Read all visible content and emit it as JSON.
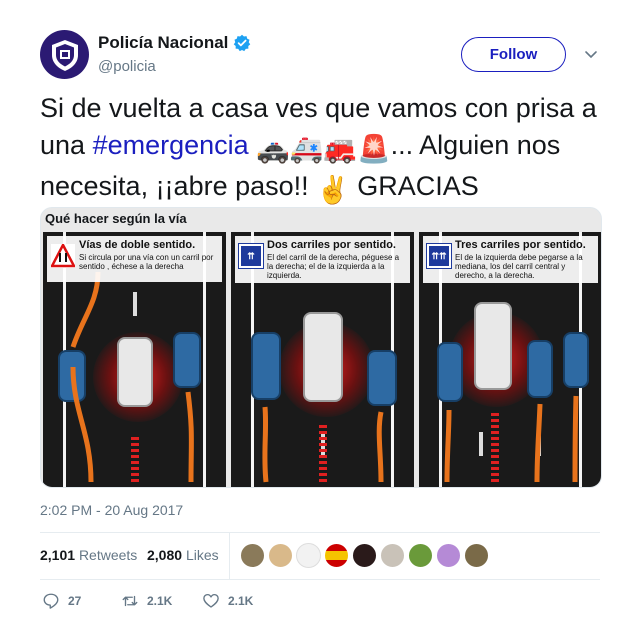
{
  "account": {
    "display_name": "Policía Nacional",
    "handle": "@policia",
    "follow_label": "Follow",
    "avatar_icon": "police-badge-icon",
    "verified_icon": "verified-badge-icon"
  },
  "tweet": {
    "text_part1": "Si de vuelta a casa ves que vamos con prisa a una ",
    "hashtag": "#emergencia",
    "text_part2": "... Alguien nos necesita, ¡¡abre paso!! ",
    "text_part3": " GRACIAS",
    "emojis_1": "🚓🚑🚒🚨",
    "emoji_2": "✌️",
    "timestamp": "2:02 PM - 20 Aug 2017"
  },
  "media": {
    "title": "Qué hacer según la vía",
    "panels": [
      {
        "sign": "⇅",
        "title": "Vías de doble sentido.",
        "desc": "Si circula por una vía con un carril por sentido , échese a la derecha"
      },
      {
        "sign": "⇈",
        "title": "Dos carriles por sentido.",
        "desc": "El del carril de la derecha, péguese a la derecha; el de la izquierda a la izquierda."
      },
      {
        "sign": "⇈⇈",
        "title": "Tres carriles por sentido.",
        "desc": "El de la izquierda debe pegarse a la mediana, los del carril central y derecho, a la derecha."
      }
    ]
  },
  "stats": {
    "retweets_count": "2,101",
    "retweets_label": "Retweets",
    "likes_count": "2,080",
    "likes_label": "Likes"
  },
  "actions": {
    "replies": "27",
    "retweets": "2.1K",
    "likes": "2.1K"
  },
  "colors": {
    "accent": "#1b1fbf",
    "muted": "#657786",
    "avatar_bg": "#2b1a73",
    "verified": "#1da1f2"
  }
}
